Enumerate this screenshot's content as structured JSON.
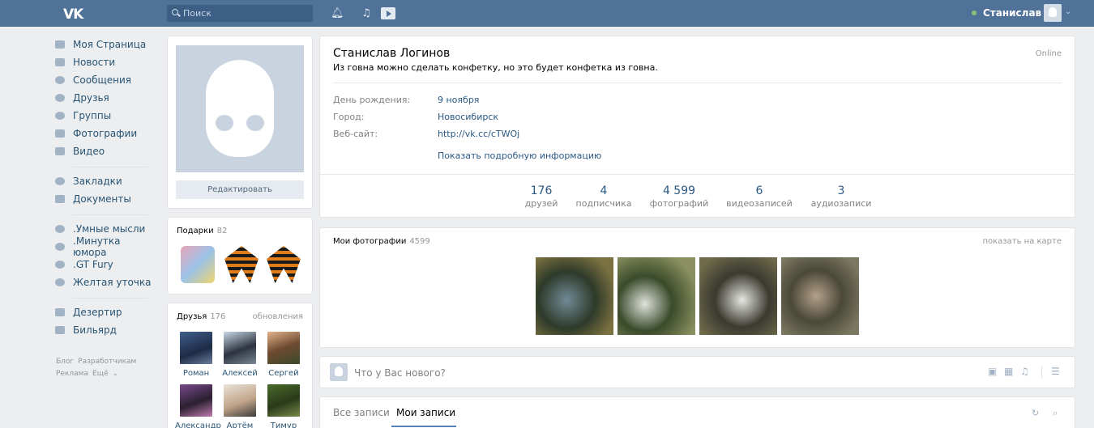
{
  "header": {
    "search_placeholder": "Поиск",
    "username": "Станислав"
  },
  "nav": {
    "items": [
      {
        "label": "Моя Страница",
        "icon": "home-icon"
      },
      {
        "label": "Новости",
        "icon": "news-icon"
      },
      {
        "label": "Сообщения",
        "icon": "messages-icon"
      },
      {
        "label": "Друзья",
        "icon": "friends-icon"
      },
      {
        "label": "Группы",
        "icon": "groups-icon"
      },
      {
        "label": "Фотографии",
        "icon": "camera-icon"
      },
      {
        "label": "Видео",
        "icon": "video-icon"
      }
    ],
    "items2": [
      {
        "label": "Закладки",
        "icon": "star-icon"
      },
      {
        "label": "Документы",
        "icon": "document-icon"
      }
    ],
    "communities": [
      {
        "label": ".Умные мысли"
      },
      {
        "label": ".Минутка юмора"
      },
      {
        "label": ".GT Fury"
      },
      {
        "label": "Желтая уточка"
      }
    ],
    "apps": [
      {
        "label": "Дезертир"
      },
      {
        "label": "Бильярд"
      }
    ],
    "footer": [
      "Блог",
      "Разработчикам",
      "Реклама",
      "Ещё"
    ]
  },
  "avatar_card": {
    "edit_label": "Редактировать"
  },
  "gifts": {
    "title": "Подарки",
    "count": "82"
  },
  "friends": {
    "title": "Друзья",
    "count": "176",
    "updates": "обновления",
    "list": [
      "Роман",
      "Алексей",
      "Сергей",
      "Александр",
      "Артём",
      "Тимур"
    ]
  },
  "profile": {
    "name": "Станислав Логинов",
    "status": "Из говна можно сделать конфетку, но это будет конфетка из говна.",
    "online": "Online",
    "birthday_label": "День рождения:",
    "birthday": "9 ноября",
    "city_label": "Город:",
    "city": "Новосибирск",
    "site_label": "Веб-сайт:",
    "site": "http://vk.cc/cTWOj",
    "more": "Показать подробную информацию",
    "counters": [
      {
        "num": "176",
        "label": "друзей"
      },
      {
        "num": "4",
        "label": "подписчика"
      },
      {
        "num": "4 599",
        "label": "фотографий"
      },
      {
        "num": "6",
        "label": "видеозаписей"
      },
      {
        "num": "3",
        "label": "аудиозаписи"
      }
    ]
  },
  "photos": {
    "title": "Мои фотографии",
    "count": "4599",
    "map_link": "показать на карте"
  },
  "post": {
    "placeholder": "Что у Вас нового?"
  },
  "wall_tabs": {
    "all": "Все записи",
    "mine": "Мои записи"
  },
  "colors": {
    "header": "#507299",
    "link": "#2a5885",
    "bg": "#edeef0"
  }
}
